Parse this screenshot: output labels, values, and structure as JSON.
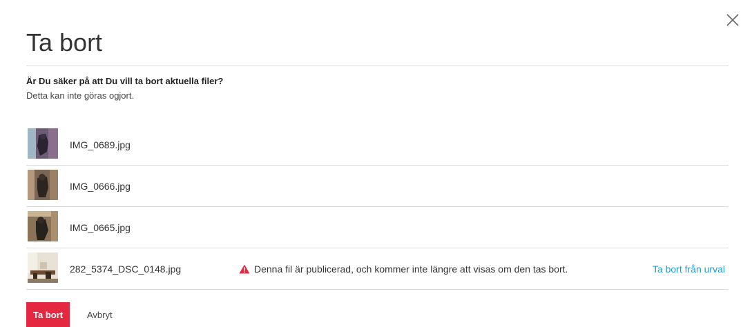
{
  "dialog": {
    "title": "Ta bort",
    "close_icon": "close-icon",
    "question": "Är Du säker på att Du vill ta bort aktuella filer?",
    "subtext": "Detta kan inte göras ogjort."
  },
  "files": [
    {
      "name": "IMG_0689.jpg"
    },
    {
      "name": "IMG_0666.jpg"
    },
    {
      "name": "IMG_0665.jpg"
    },
    {
      "name": "282_5374_DSC_0148.jpg",
      "warning": "Denna fil är publicerad, och kommer inte längre att visas om den tas bort.",
      "warning_icon": "warning-triangle-icon",
      "action": "Ta bort från urval"
    }
  ],
  "buttons": {
    "delete_label": "Ta bort",
    "cancel_label": "Avbryt"
  },
  "colors": {
    "accent": "#e3283f",
    "link": "#1a9fd9",
    "divider": "#d9d9d9"
  }
}
